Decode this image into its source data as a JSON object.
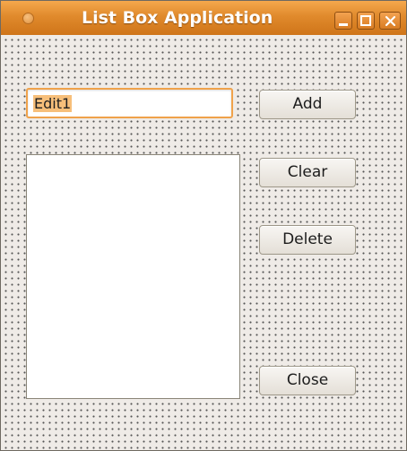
{
  "window": {
    "title": "List Box Application"
  },
  "edit": {
    "value": "Edit1"
  },
  "buttons": {
    "add": "Add",
    "clear": "Clear",
    "delete": "Delete",
    "close": "Close"
  },
  "listbox": {
    "items": []
  }
}
